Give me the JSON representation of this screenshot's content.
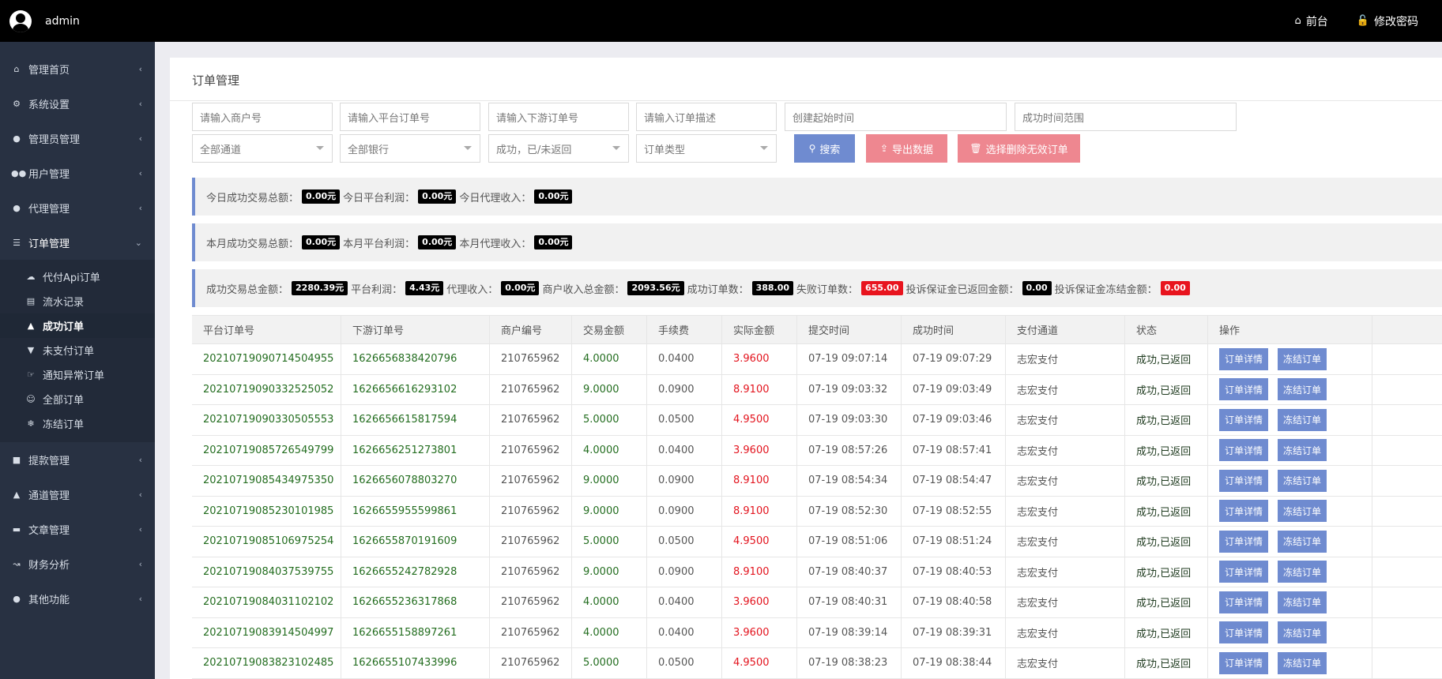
{
  "header": {
    "user": "admin",
    "links": [
      {
        "label": "前台",
        "icon": "home-icon"
      },
      {
        "label": "修改密码",
        "icon": "lock-icon"
      }
    ]
  },
  "sidebar": {
    "items": [
      {
        "label": "管理首页",
        "icon": "home-icon"
      },
      {
        "label": "系统设置",
        "icon": "gears-icon"
      },
      {
        "label": "管理员管理",
        "icon": "user-circle-icon"
      },
      {
        "label": "用户管理",
        "icon": "users-icon"
      },
      {
        "label": "代理管理",
        "icon": "user-circle-icon"
      },
      {
        "label": "订单管理",
        "icon": "list-icon"
      },
      {
        "label": "提款管理",
        "icon": "lock-icon"
      },
      {
        "label": "通道管理",
        "icon": "bank-icon"
      },
      {
        "label": "文章管理",
        "icon": "book-icon"
      },
      {
        "label": "财务分析",
        "icon": "chart-icon"
      },
      {
        "label": "其他功能",
        "icon": "user-circle-icon"
      }
    ],
    "submenu": [
      {
        "label": "代付Api订单",
        "icon": "cloud-icon"
      },
      {
        "label": "流水记录",
        "icon": "list-alt-icon"
      },
      {
        "label": "成功订单",
        "icon": "thumbs-up-icon"
      },
      {
        "label": "未支付订单",
        "icon": "thumbs-down-icon"
      },
      {
        "label": "通知异常订单",
        "icon": "hand-icon"
      },
      {
        "label": "全部订单",
        "icon": "smile-icon"
      },
      {
        "label": "冻结订单",
        "icon": "snowflake-icon"
      }
    ]
  },
  "page": {
    "title": "订单管理"
  },
  "filters": {
    "merchant_placeholder": "请输入商户号",
    "platform_order_placeholder": "请输入平台订单号",
    "downstream_order_placeholder": "请输入下游订单号",
    "order_desc_placeholder": "请输入订单描述",
    "create_time_placeholder": "创建起始时间",
    "success_time_placeholder": "成功时间范围",
    "channel": "全部通道",
    "bank": "全部银行",
    "status": "成功，已/未返回",
    "order_type": "订单类型",
    "search": "搜索",
    "export": "导出数据",
    "delete": "选择删除无效订单"
  },
  "stats": {
    "today": [
      {
        "label": "今日成功交易总额：",
        "value": "0.00元"
      },
      {
        "label": "今日平台利润：",
        "value": "0.00元"
      },
      {
        "label": "今日代理收入：",
        "value": "0.00元"
      }
    ],
    "month": [
      {
        "label": "本月成功交易总额：",
        "value": "0.00元"
      },
      {
        "label": "本月平台利润：",
        "value": "0.00元"
      },
      {
        "label": "本月代理收入：",
        "value": "0.00元"
      }
    ],
    "total": [
      {
        "label": "成功交易总金额：",
        "value": "2280.39元"
      },
      {
        "label": "平台利润：",
        "value": "4.43元"
      },
      {
        "label": "代理收入：",
        "value": "0.00元"
      },
      {
        "label": "商户收入总金额：",
        "value": "2093.56元"
      },
      {
        "label": "成功订单数：",
        "value": "388.00"
      },
      {
        "label": "失败订单数：",
        "value": "655.00"
      },
      {
        "label": "投诉保证金已返回金额：",
        "value": "0.00"
      },
      {
        "label": "投诉保证金冻结金额：",
        "value": "0.00"
      }
    ]
  },
  "table": {
    "headers": [
      "平台订单号",
      "下游订单号",
      "商户编号",
      "交易金额",
      "手续费",
      "实际金额",
      "提交时间",
      "成功时间",
      "支付通道",
      "状态",
      "操作"
    ],
    "detail_label": "订单详情",
    "freeze_label": "冻结订单",
    "rows": [
      {
        "platform": "20210719090714504955",
        "downstream": "1626656838420796",
        "merchant": "210765962",
        "amount": "4.0000",
        "fee": "0.0400",
        "actual": "3.9600",
        "submit": "07-19 09:07:14",
        "success": "07-19 09:07:29",
        "channel": "志宏支付",
        "status": "成功,已返回"
      },
      {
        "platform": "20210719090332525052",
        "downstream": "1626656616293102",
        "merchant": "210765962",
        "amount": "9.0000",
        "fee": "0.0900",
        "actual": "8.9100",
        "submit": "07-19 09:03:32",
        "success": "07-19 09:03:49",
        "channel": "志宏支付",
        "status": "成功,已返回"
      },
      {
        "platform": "20210719090330505553",
        "downstream": "1626656615817594",
        "merchant": "210765962",
        "amount": "5.0000",
        "fee": "0.0500",
        "actual": "4.9500",
        "submit": "07-19 09:03:30",
        "success": "07-19 09:03:46",
        "channel": "志宏支付",
        "status": "成功,已返回"
      },
      {
        "platform": "20210719085726549799",
        "downstream": "1626656251273801",
        "merchant": "210765962",
        "amount": "4.0000",
        "fee": "0.0400",
        "actual": "3.9600",
        "submit": "07-19 08:57:26",
        "success": "07-19 08:57:41",
        "channel": "志宏支付",
        "status": "成功,已返回"
      },
      {
        "platform": "20210719085434975350",
        "downstream": "1626656078803270",
        "merchant": "210765962",
        "amount": "9.0000",
        "fee": "0.0900",
        "actual": "8.9100",
        "submit": "07-19 08:54:34",
        "success": "07-19 08:54:47",
        "channel": "志宏支付",
        "status": "成功,已返回"
      },
      {
        "platform": "20210719085230101985",
        "downstream": "1626655955599861",
        "merchant": "210765962",
        "amount": "9.0000",
        "fee": "0.0900",
        "actual": "8.9100",
        "submit": "07-19 08:52:30",
        "success": "07-19 08:52:55",
        "channel": "志宏支付",
        "status": "成功,已返回"
      },
      {
        "platform": "20210719085106975254",
        "downstream": "1626655870191609",
        "merchant": "210765962",
        "amount": "5.0000",
        "fee": "0.0500",
        "actual": "4.9500",
        "submit": "07-19 08:51:06",
        "success": "07-19 08:51:24",
        "channel": "志宏支付",
        "status": "成功,已返回"
      },
      {
        "platform": "20210719084037539755",
        "downstream": "1626655242782928",
        "merchant": "210765962",
        "amount": "9.0000",
        "fee": "0.0900",
        "actual": "8.9100",
        "submit": "07-19 08:40:37",
        "success": "07-19 08:40:53",
        "channel": "志宏支付",
        "status": "成功,已返回"
      },
      {
        "platform": "20210719084031102102",
        "downstream": "1626655236317868",
        "merchant": "210765962",
        "amount": "4.0000",
        "fee": "0.0400",
        "actual": "3.9600",
        "submit": "07-19 08:40:31",
        "success": "07-19 08:40:58",
        "channel": "志宏支付",
        "status": "成功,已返回"
      },
      {
        "platform": "20210719083914504997",
        "downstream": "1626655158897261",
        "merchant": "210765962",
        "amount": "4.0000",
        "fee": "0.0400",
        "actual": "3.9600",
        "submit": "07-19 08:39:14",
        "success": "07-19 08:39:31",
        "channel": "志宏支付",
        "status": "成功,已返回"
      },
      {
        "platform": "20210719083823102485",
        "downstream": "1626655107433996",
        "merchant": "210765962",
        "amount": "5.0000",
        "fee": "0.0500",
        "actual": "4.9500",
        "submit": "07-19 08:38:23",
        "success": "07-19 08:38:44",
        "channel": "志宏支付",
        "status": "成功,已返回"
      }
    ]
  }
}
